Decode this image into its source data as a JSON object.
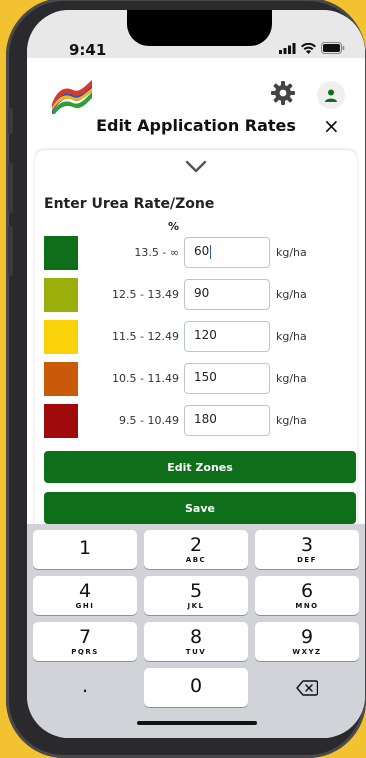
{
  "status_bar": {
    "time": "9:41"
  },
  "header": {
    "title": "Edit Application Rates",
    "close_label": "×"
  },
  "form": {
    "section_title": "Enter Urea Rate/Zone",
    "column_header": "%",
    "rows": [
      {
        "range": "13.5 - ∞",
        "value": "60",
        "unit": "kg/ha",
        "color": "#0F6E1A"
      },
      {
        "range": "12.5 - 13.49",
        "value": "90",
        "unit": "kg/ha",
        "color": "#9BAF0C"
      },
      {
        "range": "11.5 - 12.49",
        "value": "120",
        "unit": "kg/ha",
        "color": "#FAD20A"
      },
      {
        "range": "10.5 - 11.49",
        "value": "150",
        "unit": "kg/ha",
        "color": "#C85A0A"
      },
      {
        "range": "9.5 - 10.49",
        "value": "180",
        "unit": "kg/ha",
        "color": "#A00A0A"
      }
    ],
    "edit_zones_label": "Edit Zones",
    "save_label": "Save"
  },
  "keyboard": {
    "keys": [
      {
        "num": "1",
        "letters": ""
      },
      {
        "num": "2",
        "letters": "ABC"
      },
      {
        "num": "3",
        "letters": "DEF"
      },
      {
        "num": "4",
        "letters": "GHI"
      },
      {
        "num": "5",
        "letters": "JKL"
      },
      {
        "num": "6",
        "letters": "MNO"
      },
      {
        "num": "7",
        "letters": "PQRS"
      },
      {
        "num": "8",
        "letters": "TUV"
      },
      {
        "num": "9",
        "letters": "WXYZ"
      },
      {
        "num": ".",
        "letters": ""
      },
      {
        "num": "0",
        "letters": ""
      }
    ]
  },
  "colors": {
    "accent": "#0F6E1A",
    "frame": "#F2C230"
  }
}
